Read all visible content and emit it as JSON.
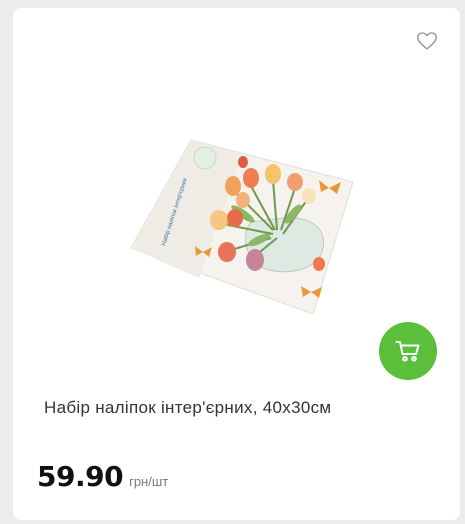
{
  "product": {
    "title": "Набір наліпок інтер'єрних, 40х30см",
    "price": "59.90",
    "unit": "грн/шт",
    "package_label": "Набір наліпок інтер'єрних",
    "image_description_icon": "flower-vase-stickers-image"
  },
  "icons": {
    "favorite": "heart-outline-icon",
    "cart": "shopping-cart-icon"
  },
  "colors": {
    "accent": "#5cbf3c",
    "background": "#ececec",
    "card": "#ffffff",
    "price": "#111111",
    "unit": "#7a7a7a"
  }
}
